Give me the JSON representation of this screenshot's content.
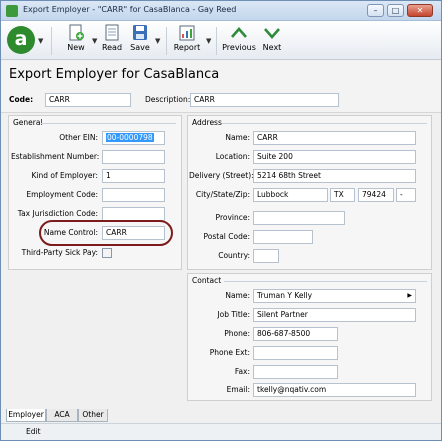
{
  "window": {
    "title": "Export Employer - \"CARR\" for CasaBlanca - Gay Reed",
    "minimize": "–",
    "maximize": "□",
    "close": "✕"
  },
  "toolbar": {
    "logo": "a",
    "new_label": "New",
    "read_label": "Read",
    "save_label": "Save",
    "report_label": "Report",
    "previous_label": "Previous",
    "next_label": "Next"
  },
  "header": {
    "title": "Export Employer for CasaBlanca",
    "code_label": "Code:",
    "code_value": "CARR",
    "description_label": "Description:",
    "description_value": "CARR"
  },
  "general": {
    "title": "General",
    "other_ein_label": "Other EIN:",
    "other_ein_value": "00-0000798",
    "establishment_number_label": "Establishment Number:",
    "establishment_number_value": "",
    "kind_of_employer_label": "Kind of Employer:",
    "kind_of_employer_value": "1",
    "employment_code_label": "Employment Code:",
    "employment_code_value": "",
    "tax_jurisdiction_code_label": "Tax Jurisdiction Code:",
    "tax_jurisdiction_code_value": "",
    "name_control_label": "Name Control:",
    "name_control_value": "CARR",
    "third_party_sick_pay_label": "Third-Party Sick Pay:"
  },
  "address": {
    "title": "Address",
    "name_label": "Name:",
    "name_value": "CARR",
    "location_label": "Location:",
    "location_value": "Suite 200",
    "delivery_label": "Delivery (Street):",
    "delivery_value": "5214 68th Street",
    "city_state_zip_label": "City/State/Zip:",
    "city_value": "Lubbock",
    "state_value": "TX",
    "zip_value": "79424",
    "zip_ext_value": "-",
    "province_label": "Province:",
    "province_value": "",
    "postal_code_label": "Postal Code:",
    "postal_code_value": "",
    "country_label": "Country:",
    "country_value": ""
  },
  "contact": {
    "title": "Contact",
    "name_label": "Name:",
    "name_value": "Truman Y Kelly",
    "job_title_label": "Job Title:",
    "job_title_value": "Silent Partner",
    "phone_label": "Phone:",
    "phone_value": "806-687-8500",
    "phone_ext_label": "Phone Ext:",
    "phone_ext_value": "",
    "fax_label": "Fax:",
    "fax_value": "",
    "email_label": "Email:",
    "email_value": "tkelly@nqativ.com"
  },
  "tabs": [
    "Employer",
    "ACA",
    "Other"
  ],
  "status": {
    "mode": "Edit"
  }
}
